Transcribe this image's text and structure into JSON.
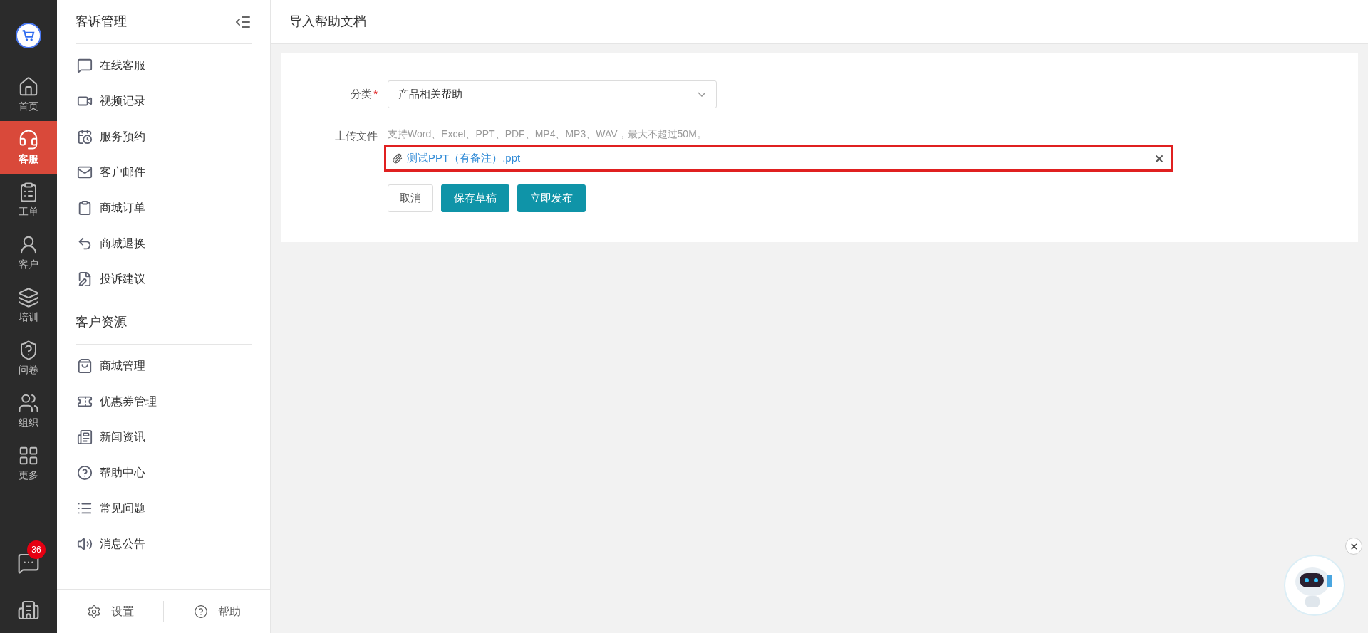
{
  "rail": {
    "items": [
      {
        "label": "首页",
        "selected": false
      },
      {
        "label": "客服",
        "selected": true
      },
      {
        "label": "工单",
        "selected": false
      },
      {
        "label": "客户",
        "selected": false
      },
      {
        "label": "培训",
        "selected": false
      },
      {
        "label": "问卷",
        "selected": false
      },
      {
        "label": "组织",
        "selected": false
      },
      {
        "label": "更多",
        "selected": false
      }
    ],
    "chat_badge": "36"
  },
  "sidebar": {
    "sections": [
      {
        "title": "客诉管理",
        "items": [
          "在线客服",
          "视频记录",
          "服务预约",
          "客户邮件",
          "商城订单",
          "商城退换",
          "投诉建议"
        ]
      },
      {
        "title": "客户资源",
        "items": [
          "商城管理",
          "优惠券管理",
          "新闻资讯",
          "帮助中心",
          "常见问题",
          "消息公告"
        ]
      }
    ],
    "footer": [
      "设置",
      "帮助"
    ]
  },
  "page": {
    "title": "导入帮助文档"
  },
  "form": {
    "category": {
      "label": "分类",
      "required_mark": "*",
      "value": "产品相关帮助"
    },
    "upload": {
      "label": "上传文件",
      "hint": "支持Word、Excel、PPT、PDF、MP4、MP3、WAV，最大不超过50M。",
      "file": "测试PPT（有备注）.ppt",
      "highlighted": true
    },
    "buttons": [
      {
        "label": "取消",
        "kind": "default"
      },
      {
        "label": "保存草稿",
        "kind": "primary"
      },
      {
        "label": "立即发布",
        "kind": "primary"
      }
    ]
  }
}
